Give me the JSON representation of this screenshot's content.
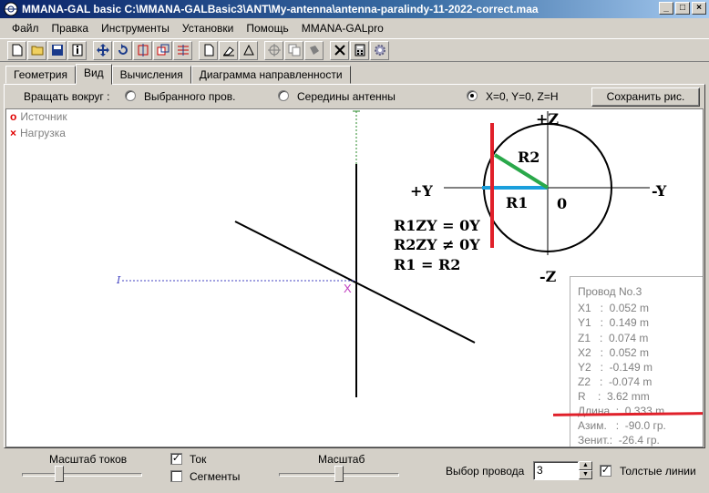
{
  "window": {
    "title": "MMANA-GAL basic C:\\MMANA-GALBasic3\\ANT\\My-antenna\\antenna-paralindy-11-2022-correct.maa",
    "minimize": "_",
    "maximize": "□",
    "close": "×"
  },
  "menu": [
    "Файл",
    "Правка",
    "Инструменты",
    "Установки",
    "Помощь",
    "MMANA-GALpro"
  ],
  "tabs": [
    "Геометрия",
    "Вид",
    "Вычисления",
    "Диаграмма направленности"
  ],
  "rotate": {
    "label": "Вращать вокруг :",
    "opt1": "Выбранного пров.",
    "opt2": "Середины антенны",
    "opt3": "X=0, Y=0, Z=H",
    "selected": "X=0, Y=0, Z=H"
  },
  "save_button": "Сохранить рис.",
  "legend": {
    "source": "Источник",
    "load": "Нагрузка"
  },
  "annotation": {
    "plus_z": "+Z",
    "minus_z": "-Z",
    "plus_y": "+Y",
    "minus_y": "-Y",
    "r1": "R1",
    "r2": "R2",
    "zero": "0",
    "eq1": "R1ZY = 0Y",
    "eq2": "R2ZY ≠ 0Y",
    "eq3": "R1 = R2",
    "wire_marker": "I"
  },
  "wire_info": {
    "title": "Провод No.3",
    "x1": "X1   :  0.052 m",
    "y1": "Y1   :  0.149 m",
    "z1": "Z1   :  0.074 m",
    "x2": "X2   :  0.052 m",
    "y2": "Y2   :  -0.149 m",
    "z2": "Z2   :  -0.074 m",
    "r": "R    :  3.62 mm",
    "length": "Длина  :  0.333 m",
    "azimuth": "Азим.   :  -90.0 гр.",
    "zenith": "Зенит.:  -26.4 гр."
  },
  "bottom": {
    "current_scale": "Масштаб токов",
    "current": "Ток",
    "segments": "Сегменты",
    "scale": "Масштаб",
    "wire_select": "Выбор провода",
    "wire_value": "3",
    "thick_lines": "Толстые линии",
    "current_checked": "✓",
    "thick_checked": "✓"
  },
  "colors": {
    "red_annotation": "#e0202a",
    "green_r2": "#2aa84a",
    "blue_r1": "#1a9fdc"
  }
}
